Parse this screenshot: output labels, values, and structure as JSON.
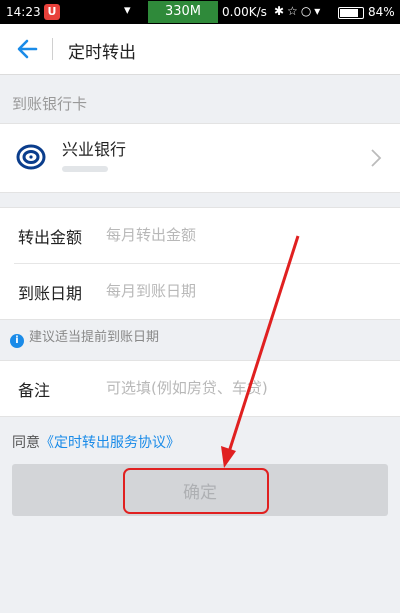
{
  "status_bar": {
    "time": "14:23",
    "app_badge": "U",
    "memory": "330M",
    "net_speed": "0.00K/s",
    "battery_percent": "84%",
    "battery_level": 0.84
  },
  "header": {
    "title": "定时转出",
    "back_icon": "arrow-left-icon"
  },
  "bank_section": {
    "label": "到账银行卡",
    "bank_name": "兴业银行",
    "logo_icon": "cib-bank-logo-icon"
  },
  "form": {
    "amount": {
      "label": "转出金额",
      "placeholder": "每月转出金额"
    },
    "date": {
      "label": "到账日期",
      "placeholder": "每月到账日期"
    }
  },
  "hint": "建议适当提前到账日期",
  "remark": {
    "label": "备注",
    "placeholder": "可选填(例如房贷、车贷)"
  },
  "agreement": {
    "prefix": "同意",
    "link": "《定时转出服务协议》"
  },
  "confirm_label": "确定",
  "colors": {
    "accent": "#1a8be8",
    "annotation": "#e02020",
    "disabled_button": "#d3d5d8"
  }
}
